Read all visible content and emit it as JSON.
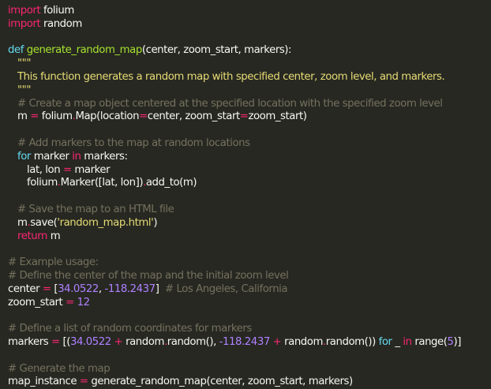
{
  "code": {
    "l1": [
      "import",
      " folium"
    ],
    "l2": [
      "import",
      " random"
    ],
    "l4": [
      "def ",
      "generate_random_map",
      "(center, zoom_start, markers):"
    ],
    "l5": "\"\"\"",
    "l6": "This function generates a random map with specified center, zoom level, and markers.",
    "l7": "\"\"\"",
    "l8": "# Create a map object centered at the specified location with the specified zoom level",
    "l9": [
      "m",
      " = ",
      "folium",
      ".",
      "Map",
      "(location",
      "=",
      "center, zoom_start",
      "=",
      "zoom_start)"
    ],
    "l11": "# Add markers to the map at random locations",
    "l12": [
      "for",
      " marker ",
      "in",
      " markers:"
    ],
    "l13": [
      "lat, lon ",
      "=",
      " marker"
    ],
    "l14": [
      "folium",
      ".",
      "Marker",
      "([lat, lon])",
      ".",
      "add_to(m)"
    ],
    "l16": "# Save the map to an HTML file",
    "l17": [
      "m",
      ".",
      "save(",
      "'random_map.html'",
      ")"
    ],
    "l18": [
      "return",
      " m"
    ],
    "l20": "# Example usage:",
    "l21": "# Define the center of the map and the initial zoom level",
    "l22": [
      "center ",
      "=",
      " [",
      "34.0522",
      ", ",
      "-118.2437",
      "]  ",
      "# Los Angeles, California"
    ],
    "l23": [
      "zoom_start ",
      "=",
      " ",
      "12"
    ],
    "l25": "# Define a list of random coordinates for markers",
    "l26": [
      "markers ",
      "=",
      " [(",
      "34.0522",
      " ",
      "+",
      " random",
      ".",
      "random(), ",
      "-118.2437",
      " ",
      "+",
      " random",
      ".",
      "random()) ",
      "for",
      " _ ",
      "in",
      " range(",
      "5",
      ")]"
    ],
    "l28": "# Generate the map",
    "l29": [
      "map_instance ",
      "=",
      " generate_random_map(center, zoom_start, markers)"
    ]
  },
  "colors": {
    "background": "#272822",
    "keyword": "#f92672",
    "function": "#a6e22e",
    "number": "#ae81ff",
    "string": "#e6db74",
    "comment": "#75715e",
    "text": "#f8f8f2"
  }
}
